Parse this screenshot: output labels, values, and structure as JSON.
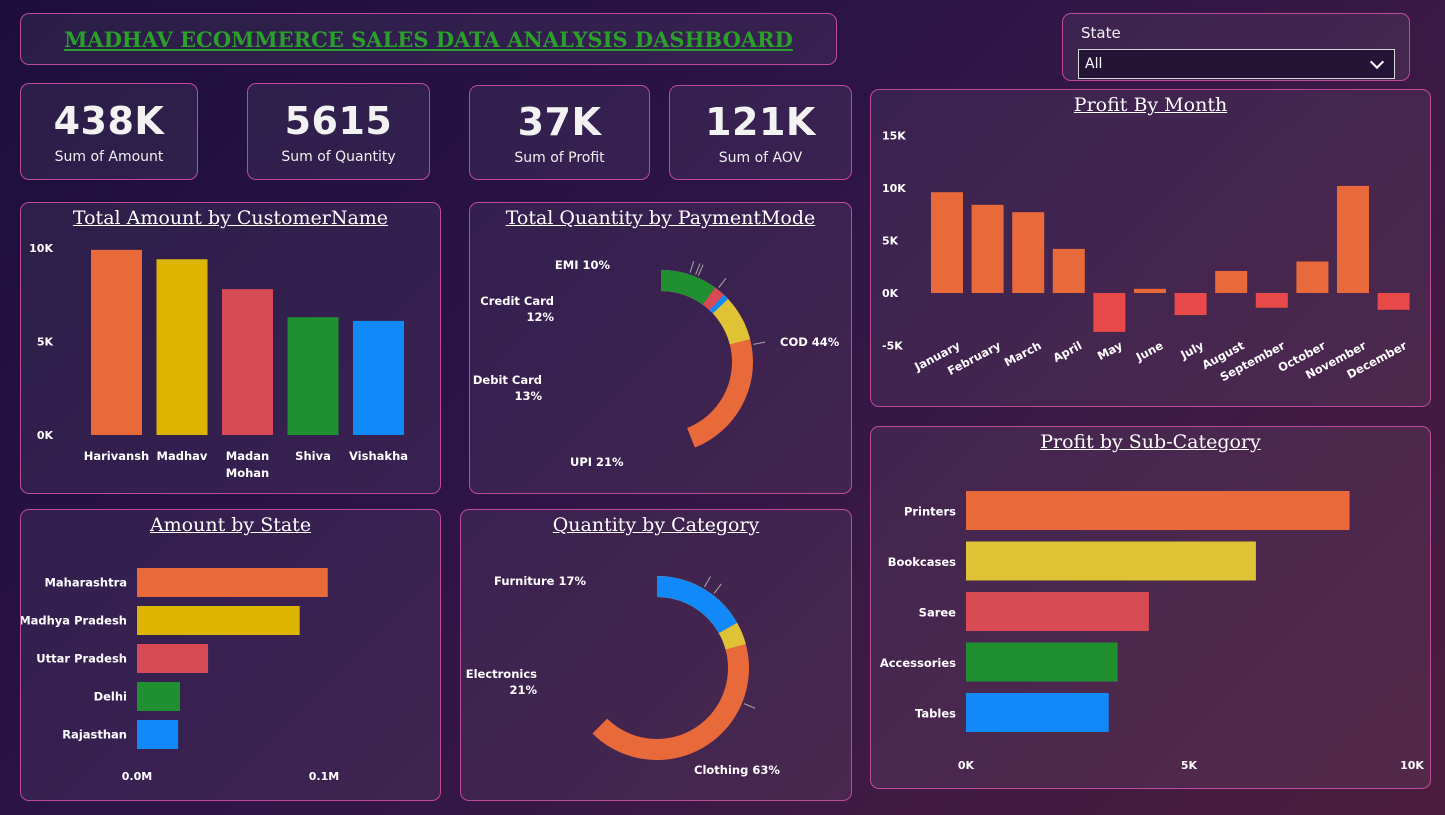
{
  "dashboard": {
    "title": "MADHAV ECOMMERCE SALES DATA ANALYSIS DASHBOARD"
  },
  "slicer": {
    "label": "State",
    "selected": "All"
  },
  "kpis": [
    {
      "value": "438K",
      "label": "Sum of Amount"
    },
    {
      "value": "5615",
      "label": "Sum of Quantity"
    },
    {
      "value": "37K",
      "label": "Sum of Profit"
    },
    {
      "value": "121K",
      "label": "Sum of AOV"
    }
  ],
  "colors": {
    "orange": "#e8693a",
    "yellow": "#ddb400",
    "yellow_light": "#e0c235",
    "red": "#d84a54",
    "green": "#1f8f30",
    "blue": "#1189f8",
    "neg_red": "#e84a4a"
  },
  "chart_data": [
    {
      "id": "amount_by_customer",
      "type": "bar",
      "title": "Total Amount by CustomerName",
      "categories": [
        "Harivansh",
        "Madhav",
        "Madan Mohan",
        "Shiva",
        "Vishakha"
      ],
      "values": [
        9900,
        9400,
        7800,
        6300,
        6100
      ],
      "ylim": [
        0,
        10000
      ],
      "yticks": [
        "0K",
        "5K",
        "10K"
      ],
      "colors": [
        "#e8693a",
        "#ddb400",
        "#d84a54",
        "#1f8f30",
        "#1189f8"
      ]
    },
    {
      "id": "quantity_by_paymentmode",
      "type": "pie",
      "title": "Total Quantity by PaymentMode",
      "categories": [
        "COD",
        "UPI",
        "Debit Card",
        "Credit Card",
        "EMI"
      ],
      "values": [
        44,
        21,
        13,
        12,
        10
      ],
      "labels": [
        "COD 44%",
        "UPI 21%",
        "Debit Card 13%",
        "Credit Card 12%",
        "EMI 10%"
      ],
      "colors": [
        "#e8693a",
        "#e0c235",
        "#1189f8",
        "#d84a54",
        "#1f8f30"
      ]
    },
    {
      "id": "profit_by_month",
      "type": "bar",
      "title": "Profit By Month",
      "categories": [
        "January",
        "February",
        "March",
        "April",
        "May",
        "June",
        "July",
        "August",
        "September",
        "October",
        "November",
        "December"
      ],
      "values": [
        9600,
        8400,
        7700,
        4200,
        -3700,
        400,
        -2100,
        2100,
        -1400,
        3000,
        10200,
        -1600
      ],
      "ylim": [
        -5000,
        15000
      ],
      "yticks": [
        "-5K",
        "0K",
        "5K",
        "10K",
        "15K"
      ]
    },
    {
      "id": "amount_by_state",
      "type": "bar",
      "title": "Amount by State",
      "categories": [
        "Maharashtra",
        "Madhya Pradesh",
        "Uttar Pradesh",
        "Delhi",
        "Rajasthan"
      ],
      "values": [
        102000,
        87000,
        38000,
        23000,
        22000
      ],
      "xticks": [
        "0.0M",
        "0.1M"
      ],
      "colors": [
        "#e8693a",
        "#ddb400",
        "#d84a54",
        "#1f8f30",
        "#1189f8"
      ]
    },
    {
      "id": "quantity_by_category",
      "type": "pie",
      "title": "Quantity by Category",
      "categories": [
        "Clothing",
        "Electronics",
        "Furniture"
      ],
      "values": [
        63,
        21,
        17
      ],
      "labels": [
        "Clothing 63%",
        "Electronics 21%",
        "Furniture 17%"
      ],
      "colors": [
        "#e8693a",
        "#e0c235",
        "#1189f8"
      ]
    },
    {
      "id": "profit_by_subcategory",
      "type": "bar",
      "title": "Profit by Sub-Category",
      "categories": [
        "Printers",
        "Bookcases",
        "Saree",
        "Accessories",
        "Tables"
      ],
      "values": [
        8600,
        6500,
        4100,
        3400,
        3200
      ],
      "xlim": [
        0,
        10000
      ],
      "xticks": [
        "0K",
        "5K",
        "10K"
      ],
      "colors": [
        "#e8693a",
        "#e0c235",
        "#d84a54",
        "#1f8f30",
        "#1189f8"
      ]
    }
  ]
}
